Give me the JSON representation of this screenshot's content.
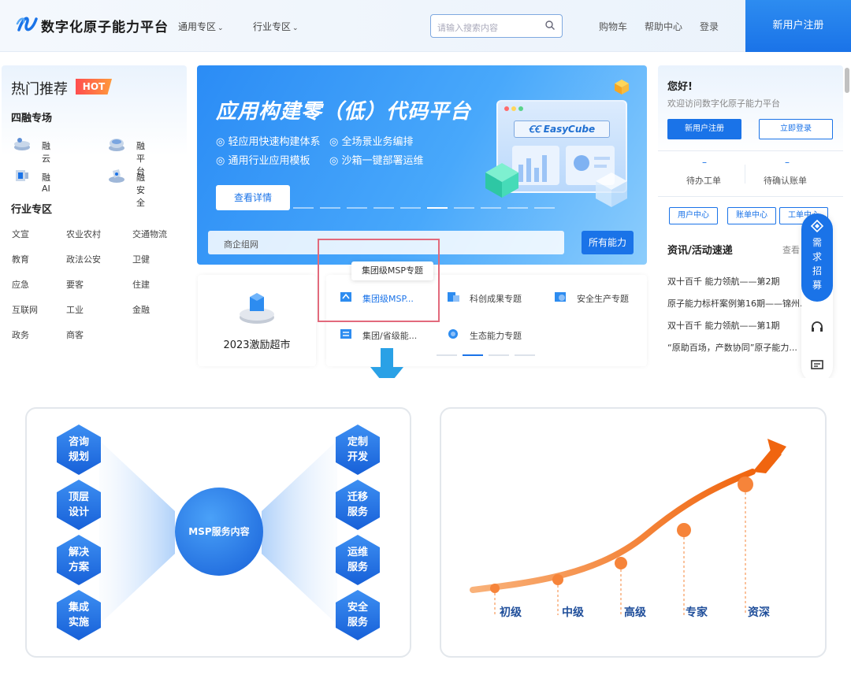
{
  "header": {
    "logo_text": "数字化原子能力平台",
    "nav": [
      {
        "label": "通用专区"
      },
      {
        "label": "行业专区"
      }
    ],
    "search_placeholder": "请输入搜索内容",
    "links": [
      "购物车",
      "帮助中心",
      "登录"
    ],
    "register": "新用户注册"
  },
  "left": {
    "title": "热门推荐",
    "badge": "HOT",
    "fusion_title": "四融专场",
    "fusion_items": [
      "融云",
      "融平台",
      "融AI",
      "融安全"
    ],
    "industry_title": "行业专区",
    "industries": [
      "文宣",
      "农业农村",
      "交通物流",
      "教育",
      "政法公安",
      "卫健",
      "应急",
      "要客",
      "住建",
      "互联网",
      "工业",
      "金融",
      "政务",
      "商客"
    ]
  },
  "banner": {
    "title": "应用构建零（低）代码平台",
    "features": [
      "轻应用快速构建体系",
      "全场景业务编排",
      "通用行业应用模板",
      "沙箱一键部署运维"
    ],
    "detail_button": "查看详情",
    "product": "EasyCube",
    "search_text": "商企组网",
    "all_button": "所有能力"
  },
  "incentive": {
    "label": "2023激励超市"
  },
  "topics": {
    "items": [
      "集团级MSP...",
      "科创成果专题",
      "安全生产专题",
      "集团/省级能...",
      "生态能力专题"
    ],
    "tooltip": "集团级MSP专题"
  },
  "right": {
    "hello": "您好!",
    "welcome": "欢迎访问数字化原子能力平台",
    "register_button": "新用户注册",
    "login_button": "立即登录",
    "todo": [
      {
        "count": "–",
        "label": "待办工单"
      },
      {
        "count": "–",
        "label": "待确认账单"
      }
    ],
    "quick": [
      "用户中心",
      "账单中心",
      "工单中心"
    ],
    "news_title": "资讯/活动速递",
    "news_more": "查看",
    "news": [
      "双十百千 能力领航——第2期",
      "原子能力标杆案例第16期——锦州...",
      "双十百千 能力领航——第1期",
      "“原助百场，产数协同”原子能力..."
    ]
  },
  "float": {
    "demand": "需求招募"
  },
  "msp": {
    "center": "MSP服务内容",
    "left": [
      "咨询规划",
      "顶层设计",
      "解决方案",
      "集成实施"
    ],
    "right": [
      "定制开发",
      "迁移服务",
      "运维服务",
      "安全服务"
    ]
  },
  "growth": {
    "levels": [
      "初级",
      "中级",
      "高级",
      "专家",
      "资深"
    ],
    "curve_color": "#f07a1a"
  },
  "colors": {
    "accent": "#1a73e8",
    "highlight": "#e26a7c",
    "hot": "#ff4d4f"
  }
}
